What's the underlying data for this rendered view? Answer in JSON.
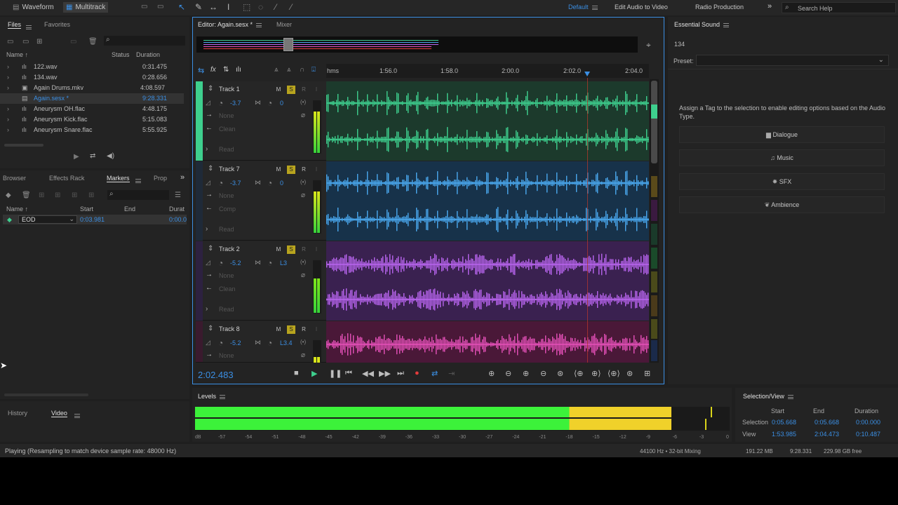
{
  "toolbar": {
    "waveform_label": "Waveform",
    "multitrack_label": "Multitrack",
    "workspaces": [
      "Default",
      "Edit Audio to Video",
      "Radio Production"
    ],
    "search_placeholder": "Search Help"
  },
  "files_panel": {
    "tabs": [
      "Files",
      "Favorites"
    ],
    "col_name": "Name ↑",
    "col_status": "Status",
    "col_duration": "Duration",
    "files": [
      {
        "name": "122.wav",
        "duration": "0:31.475"
      },
      {
        "name": "134.wav",
        "duration": "0:28.656"
      },
      {
        "name": "Again Drums.mkv",
        "duration": "4:08.597"
      },
      {
        "name": "Again.sesx *",
        "duration": "9:28.331"
      },
      {
        "name": "Aneurysm OH.flac",
        "duration": "4:48.175"
      },
      {
        "name": "Aneurysm Kick.flac",
        "duration": "5:15.083"
      },
      {
        "name": "Aneurysm Snare.flac",
        "duration": "5:55.925"
      }
    ]
  },
  "markers_panel": {
    "tabs": [
      "Browser",
      "Effects Rack",
      "Markers",
      "Prop"
    ],
    "col_name": "Name ↑",
    "col_start": "Start",
    "col_end": "End",
    "col_duration": "Durat",
    "marker": {
      "name": "EOD",
      "start": "0:03.981",
      "duration": "0:00.0"
    }
  },
  "history_panel": {
    "tabs": [
      "History",
      "Video"
    ]
  },
  "editor": {
    "tab_editor": "Editor: Again.sesx *",
    "tab_mixer": "Mixer",
    "ruler_unit": "hms",
    "ruler_labels": [
      "1:56.0",
      "1:58.0",
      "2:00.0",
      "2:02.0",
      "2:04.0"
    ],
    "time_display": "2:02.483",
    "tracks": [
      {
        "name": "Track 1",
        "volume": "-3.7",
        "pan": "0",
        "input": "None",
        "output": "Clean",
        "mode": "Read",
        "color": "#3ecf8e",
        "bg": "#1c3a2c"
      },
      {
        "name": "Track 7",
        "volume": "-3.7",
        "pan": "0",
        "input": "None",
        "output": "Comp",
        "mode": "Read",
        "color": "#4aa8ee",
        "bg": "#17324a"
      },
      {
        "name": "Track 2",
        "volume": "-5.2",
        "pan": "L3",
        "input": "None",
        "output": "Clean",
        "mode": "Read",
        "color": "#b864ee",
        "bg": "#3a2150"
      },
      {
        "name": "Track 8",
        "volume": "-5.2",
        "pan": "L3.4",
        "input": "None",
        "output": "",
        "mode": "",
        "color": "#e550b8",
        "bg": "#4a1838"
      }
    ]
  },
  "essential_sound": {
    "title": "Essential Sound",
    "clip_name": "134",
    "preset_label": "Preset:",
    "hint": "Assign a Tag to the selection to enable editing options based on the Audio Type.",
    "buttons": [
      "Dialogue",
      "Music",
      "SFX",
      "Ambience"
    ]
  },
  "levels": {
    "title": "Levels",
    "db_labels": [
      "dB",
      "-57",
      "-54",
      "-51",
      "-48",
      "-45",
      "-42",
      "-39",
      "-36",
      "-33",
      "-30",
      "-27",
      "-24",
      "-21",
      "-18",
      "-15",
      "-12",
      "-9",
      "-6",
      "-3",
      "0"
    ],
    "level_db": -6.5
  },
  "selection_view": {
    "title": "Selection/View",
    "col_start": "Start",
    "col_end": "End",
    "col_duration": "Duration",
    "selection_label": "Selection",
    "view_label": "View",
    "selection": {
      "start": "0:05.668",
      "end": "0:05.668",
      "duration": "0:00.000"
    },
    "view": {
      "start": "1:53.985",
      "end": "2:04.473",
      "duration": "0:10.487"
    }
  },
  "status": {
    "message": "Playing (Resampling to match device sample rate: 48000 Hz)",
    "sample_rate": "44100 Hz • 32-bit Mixing",
    "memory": "191.22 MB",
    "duration": "9:28.331",
    "disk_free": "229.98 GB free"
  }
}
